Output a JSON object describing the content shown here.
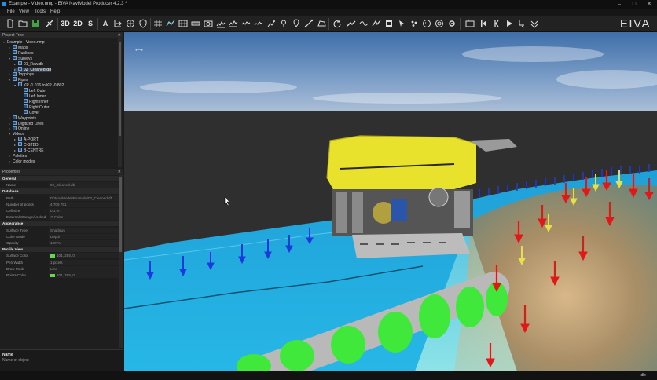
{
  "window": {
    "title": "Example - Video.nmp - EIVA NaviModel Producer 4.2.3 *",
    "controls": [
      "–",
      "□",
      "✕"
    ]
  },
  "menu": [
    "File",
    "View",
    "Tools",
    "Help"
  ],
  "toolbar": {
    "view_3d": "3D",
    "view_2d": "2D",
    "view_s": "S",
    "view_a": "A",
    "logo": "EIVA"
  },
  "project_tree": {
    "header": "Project Tree",
    "close": "✕",
    "items": [
      {
        "label": "Example - Video.nmp",
        "indent": 0,
        "checkbox": false,
        "arrow": "▾",
        "selected": false
      },
      {
        "label": "Maps",
        "indent": 1,
        "checkbox": true,
        "arrow": "▸",
        "selected": false
      },
      {
        "label": "Runlines",
        "indent": 1,
        "checkbox": true,
        "arrow": "▸",
        "selected": false
      },
      {
        "label": "Surveys",
        "indent": 1,
        "checkbox": true,
        "arrow": "▾",
        "selected": false
      },
      {
        "label": "01_Raw.db",
        "indent": 2,
        "checkbox": true,
        "arrow": "▸",
        "selected": false
      },
      {
        "label": "02_Cleaned.db",
        "indent": 2,
        "checkbox": true,
        "arrow": "▸",
        "selected": true
      },
      {
        "label": "Toppings",
        "indent": 1,
        "checkbox": true,
        "arrow": "▸",
        "selected": false
      },
      {
        "label": "Pipes",
        "indent": 1,
        "checkbox": true,
        "arrow": "▾",
        "selected": false
      },
      {
        "label": "KP -1.016 to KP -0.802",
        "indent": 2,
        "checkbox": true,
        "arrow": "▾",
        "selected": false
      },
      {
        "label": "Left Outer",
        "indent": 3,
        "checkbox": true,
        "arrow": "",
        "selected": false
      },
      {
        "label": "Left Inner",
        "indent": 3,
        "checkbox": true,
        "arrow": "",
        "selected": false
      },
      {
        "label": "Right Inner",
        "indent": 3,
        "checkbox": true,
        "arrow": "",
        "selected": false
      },
      {
        "label": "Right Outer",
        "indent": 3,
        "checkbox": true,
        "arrow": "",
        "selected": false
      },
      {
        "label": "Cover",
        "indent": 3,
        "checkbox": true,
        "arrow": "",
        "selected": false
      },
      {
        "label": "Waypoints",
        "indent": 1,
        "checkbox": true,
        "arrow": "▸",
        "selected": false
      },
      {
        "label": "Digitized Lines",
        "indent": 1,
        "checkbox": true,
        "arrow": "▸",
        "selected": false
      },
      {
        "label": "Online",
        "indent": 1,
        "checkbox": true,
        "arrow": "▸",
        "selected": false
      },
      {
        "label": "Videos",
        "indent": 1,
        "checkbox": false,
        "arrow": "▾",
        "selected": false
      },
      {
        "label": "A-PORT",
        "indent": 2,
        "checkbox": true,
        "arrow": "▸",
        "selected": false
      },
      {
        "label": "C-STBD",
        "indent": 2,
        "checkbox": true,
        "arrow": "▸",
        "selected": false
      },
      {
        "label": "B-CENTRE",
        "indent": 2,
        "checkbox": true,
        "arrow": "▸",
        "selected": false
      },
      {
        "label": "Palettes",
        "indent": 1,
        "checkbox": false,
        "arrow": "▸",
        "selected": false
      },
      {
        "label": "Color modes",
        "indent": 1,
        "checkbox": false,
        "arrow": "▸",
        "selected": false
      }
    ]
  },
  "properties": {
    "header": "Properties",
    "close": "✕",
    "rows": [
      {
        "type": "section",
        "label": "General"
      },
      {
        "type": "row",
        "key": "Name",
        "value": "02_Cleaned.db"
      },
      {
        "type": "section",
        "label": "Database"
      },
      {
        "type": "row",
        "key": "Path",
        "value": "D:\\NaviModel\\Example\\02_Cleaned.db"
      },
      {
        "type": "row",
        "key": "Number of points",
        "value": "4 706 781"
      },
      {
        "type": "row",
        "key": "Cell size",
        "value": "0.1 m"
      },
      {
        "type": "row",
        "key": "External Storage/Locked",
        "value": "✕   False"
      },
      {
        "type": "section",
        "label": "Appearance"
      },
      {
        "type": "row",
        "key": "Surface Type",
        "value": "Shadows"
      },
      {
        "type": "row",
        "key": "Color Mode",
        "value": "Depth"
      },
      {
        "type": "row",
        "key": "Opacity",
        "value": "100 %"
      },
      {
        "type": "section",
        "label": "Profile View"
      },
      {
        "type": "row",
        "key": "Surface Color",
        "value": "101, 255, 0",
        "swatch": "#63d84a"
      },
      {
        "type": "row",
        "key": "Pen Width",
        "value": "1 pixels"
      },
      {
        "type": "row",
        "key": "Draw Mode",
        "value": "Line"
      },
      {
        "type": "row",
        "key": "Points Color",
        "value": "101, 255, 0",
        "swatch": "#63d84a"
      }
    ]
  },
  "name_box": {
    "title": "Name",
    "description": "Name of object"
  },
  "status": {
    "right": "Idle"
  },
  "colors": {
    "accent": "#2b8fd8",
    "pipe_green": "#3fe83a",
    "arrow_red": "#e01818",
    "arrow_blue": "#1a3adc",
    "arrow_yellow": "#e6e04a",
    "rov_yellow": "#e8e22c"
  }
}
